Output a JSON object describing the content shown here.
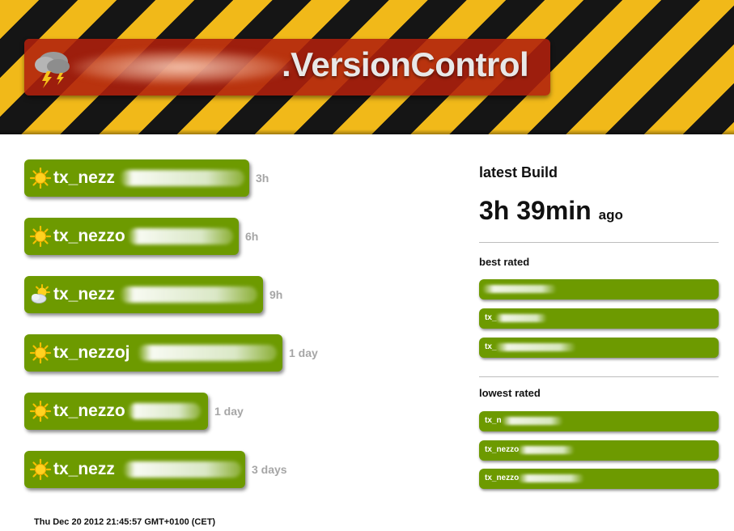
{
  "header": {
    "title": ".VersionControl",
    "icon": "storm-cloud-icon"
  },
  "builds": [
    {
      "name": "tx_nezz",
      "age": "3h",
      "icon": "sun-icon"
    },
    {
      "name": "tx_nezzo",
      "age": "6h",
      "icon": "sun-icon"
    },
    {
      "name": "tx_nezz",
      "age": "9h",
      "icon": "partly-cloudy-icon"
    },
    {
      "name": "tx_nezzoj",
      "age": "1 day",
      "icon": "sun-icon"
    },
    {
      "name": "tx_nezzo",
      "age": "1 day",
      "icon": "sun-icon"
    },
    {
      "name": "tx_nezz",
      "age": "3 days",
      "icon": "sun-icon"
    }
  ],
  "latest": {
    "label": "latest Build",
    "value": "3h 39min",
    "suffix": "ago"
  },
  "best_rated": {
    "label": "best rated",
    "items": [
      "",
      "tx_",
      "tx_"
    ]
  },
  "lowest_rated": {
    "label": "lowest rated",
    "items": [
      "tx_n",
      "tx_nezzo",
      "tx_nezzo"
    ]
  },
  "footer": {
    "timestamp": "Thu Dec 20 2012 21:45:57 GMT+0100 (CET)"
  },
  "colors": {
    "stripe_yellow": "#f1b919",
    "stripe_black": "#151515",
    "title_red": "#b0200c",
    "build_green": "#6d9a00",
    "age_gray": "#a6a6a6"
  }
}
